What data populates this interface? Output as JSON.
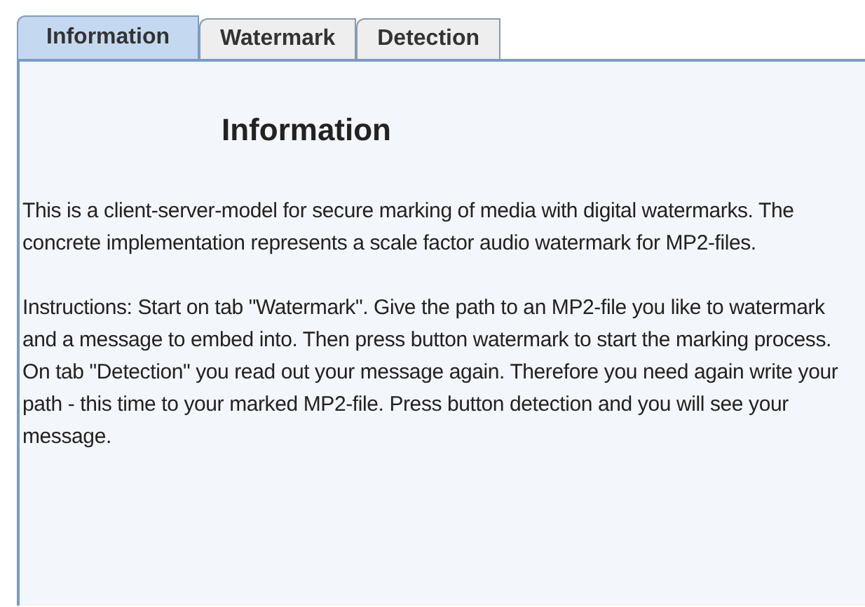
{
  "tabs": [
    {
      "label": "Information",
      "selected": true
    },
    {
      "label": "Watermark",
      "selected": false
    },
    {
      "label": "Detection",
      "selected": false
    }
  ],
  "panel": {
    "heading": "Information",
    "paragraphs": [
      "This is a client-server-model for secure marking of media with digital watermarks. The concrete implementation represents a scale factor audio watermark for MP2-files.",
      "Instructions: Start on tab \"Watermark\". Give the path to an MP2-file you like to watermark and a message to embed into. Then press button watermark to start the marking process. On tab \"Detection\" you read out your message again. Therefore you need again write your path - this time to your marked MP2-file. Press button detection and you will see your message."
    ]
  }
}
